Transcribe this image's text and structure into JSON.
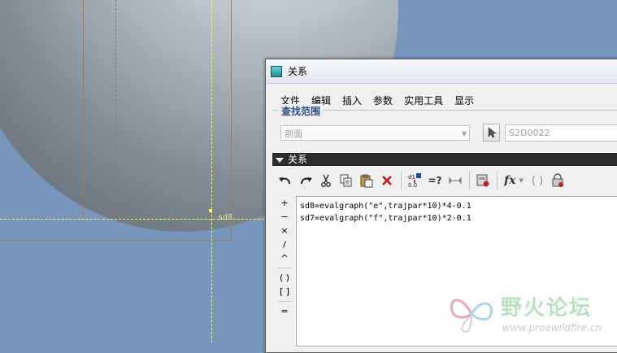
{
  "viewport": {
    "dimension_label": "sd8"
  },
  "dialog": {
    "title": "关系",
    "menu": [
      "文件",
      "编辑",
      "插入",
      "参数",
      "实用工具",
      "显示"
    ],
    "search": {
      "title": "查找范围",
      "scope_value": "剖面",
      "feature_value": "S2D0022"
    },
    "relations_header": "关系",
    "toolbar_icons": [
      "undo-icon",
      "redo-icon",
      "cut-icon",
      "copy-icon",
      "paste-icon",
      "delete-icon",
      "display-dims-icon",
      "evaluate-icon",
      "sort-icon",
      "verify-icon",
      "insert-function-icon",
      "parentheses-icon",
      "lock-icon"
    ],
    "toolbar_glyphs": {
      "fx": "fx",
      "eval": "=?",
      "parens": "( )"
    },
    "operators": [
      "+",
      "−",
      "×",
      "/",
      "^",
      "( )",
      "[ ]",
      "="
    ],
    "relations": [
      "sd8=evalgraph(\"e\",trajpar*10)*4-0.1",
      "sd7=evalgraph(\"f\",trajpar*10)*2-0.1"
    ],
    "colors": {
      "header_bg": "#2b2b2b",
      "search_title": "#2a4e86"
    }
  },
  "watermark": {
    "text": "野火论坛",
    "url": "www.proewildfire.cn"
  }
}
